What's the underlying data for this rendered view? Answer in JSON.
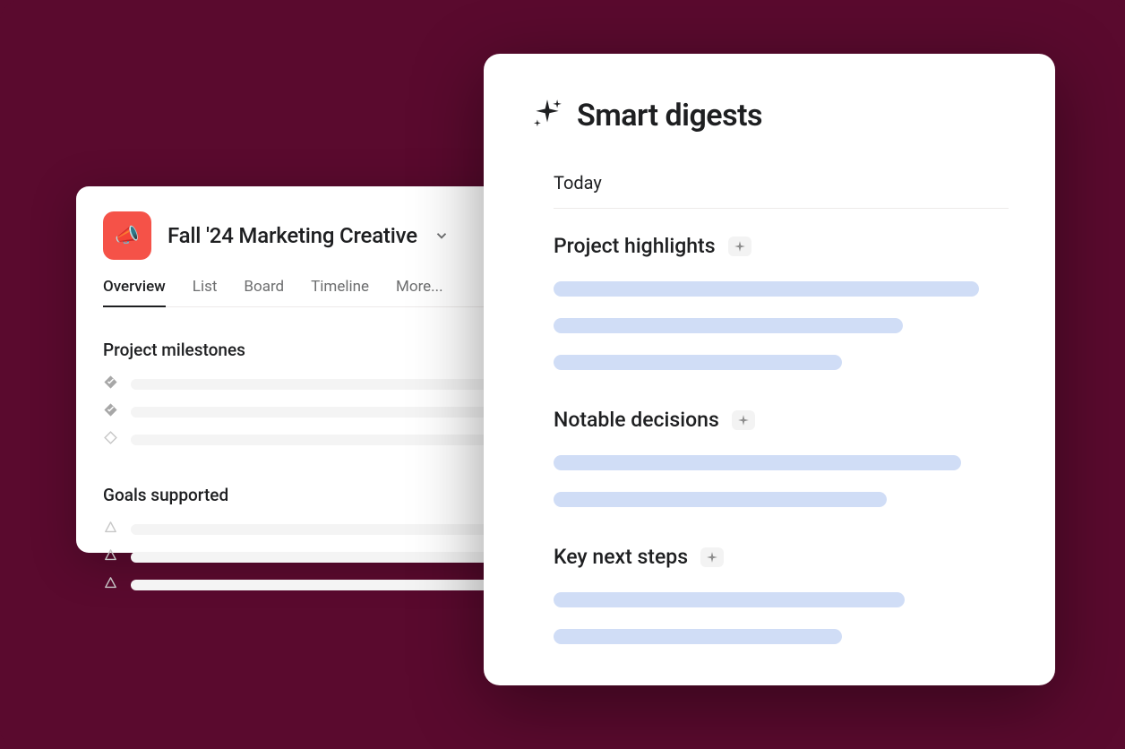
{
  "project": {
    "title": "Fall '24 Marketing Creative",
    "icon_emoji": "📣",
    "tabs": [
      "Overview",
      "List",
      "Board",
      "Timeline",
      "More..."
    ],
    "active_tab_index": 0,
    "sections": {
      "milestones_title": "Project milestones",
      "goals_title": "Goals supported"
    }
  },
  "digest": {
    "title": "Smart digests",
    "today_label": "Today",
    "sections": [
      {
        "heading": "Project highlights"
      },
      {
        "heading": "Notable decisions"
      },
      {
        "heading": "Key next steps"
      }
    ]
  }
}
